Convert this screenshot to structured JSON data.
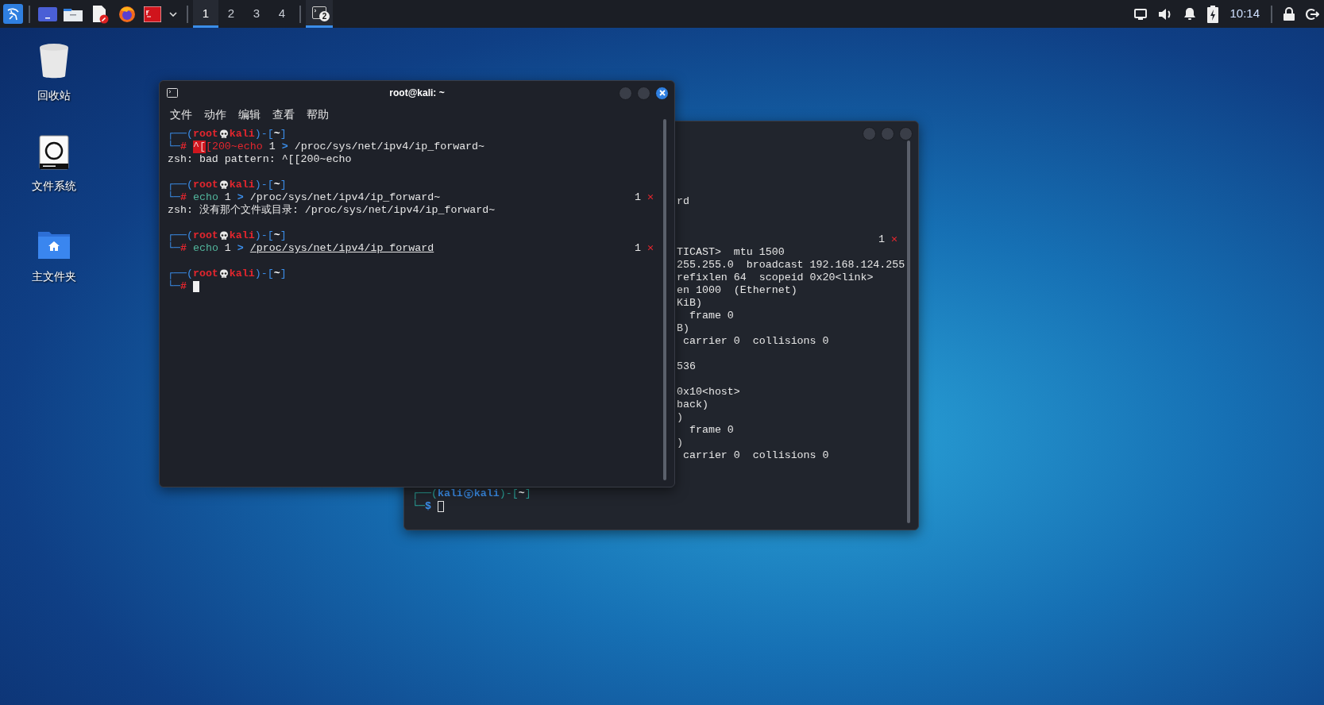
{
  "taskbar": {
    "workspaces": [
      {
        "label": "1",
        "selected": true
      },
      {
        "label": "2",
        "selected": false
      },
      {
        "label": "3",
        "selected": false
      },
      {
        "label": "4",
        "selected": false
      }
    ],
    "tasks": [
      {
        "badge": "2",
        "selected": true
      }
    ],
    "clock": "10:14"
  },
  "desktop_icons": [
    {
      "kind": "trash",
      "label": "回收站"
    },
    {
      "kind": "drive",
      "label": "文件系统"
    },
    {
      "kind": "home",
      "label": "主文件夹"
    }
  ],
  "windows": [
    {
      "title": "root@kali: ~",
      "active": true,
      "root": true,
      "menu": [
        "文件",
        "动作",
        "编辑",
        "查看",
        "帮助"
      ],
      "lines": [
        {
          "kind": "text",
          "cursor": false,
          "segments": [
            {
              "kind": "frame",
              "text": "┌──("
            },
            {
              "kind": "user",
              "text": "root"
            },
            {
              "kind": "skull"
            },
            {
              "kind": "host",
              "text": "kali"
            },
            {
              "kind": "frame",
              "text": ")-["
            },
            {
              "kind": "dir",
              "text": "~"
            },
            {
              "kind": "frame",
              "text": "]"
            }
          ]
        },
        {
          "kind": "text",
          "cursor": false,
          "segments": [
            {
              "kind": "frame",
              "text": "└─"
            },
            {
              "kind": "symbol",
              "text": "#"
            },
            {
              "kind": "esc",
              "text": "^["
            },
            {
              "kind": "badcmd",
              "text": "[200~echo"
            },
            {
              "kind": "arg",
              "text": " 1 "
            },
            {
              "kind": "op",
              "text": ">"
            },
            {
              "kind": "arg",
              "text": " /proc/sys/net/ipv4/ip_forward~"
            }
          ]
        },
        {
          "kind": "text",
          "cursor": false,
          "segments": [
            {
              "kind": "text",
              "text": "zsh: bad pattern: ^[[200~echo"
            }
          ]
        },
        {
          "kind": "blank"
        },
        {
          "kind": "text",
          "cursor": false,
          "segments": [
            {
              "kind": "frame",
              "text": "┌──("
            },
            {
              "kind": "user",
              "text": "root"
            },
            {
              "kind": "skull"
            },
            {
              "kind": "host",
              "text": "kali"
            },
            {
              "kind": "frame",
              "text": ")-["
            },
            {
              "kind": "dir",
              "text": "~"
            },
            {
              "kind": "frame",
              "text": "]"
            }
          ]
        },
        {
          "kind": "text",
          "cursor": false,
          "status": "1",
          "status_mark": "✕",
          "segments": [
            {
              "kind": "frame",
              "text": "└─"
            },
            {
              "kind": "symbol",
              "text": "#"
            },
            {
              "kind": "cmd",
              "text": "echo"
            },
            {
              "kind": "arg",
              "text": " 1 "
            },
            {
              "kind": "op",
              "text": ">"
            },
            {
              "kind": "arg",
              "text": " /proc/sys/net/ipv4/ip_forward~"
            }
          ]
        },
        {
          "kind": "text",
          "cursor": false,
          "segments": [
            {
              "kind": "text",
              "text": "zsh: 没有那个文件或目录: /proc/sys/net/ipv4/ip_forward~"
            }
          ]
        },
        {
          "kind": "blank"
        },
        {
          "kind": "text",
          "cursor": false,
          "segments": [
            {
              "kind": "frame",
              "text": "┌──("
            },
            {
              "kind": "user",
              "text": "root"
            },
            {
              "kind": "skull"
            },
            {
              "kind": "host",
              "text": "kali"
            },
            {
              "kind": "frame",
              "text": ")-["
            },
            {
              "kind": "dir",
              "text": "~"
            },
            {
              "kind": "frame",
              "text": "]"
            }
          ]
        },
        {
          "kind": "text",
          "cursor": false,
          "status": "1",
          "status_mark": "✕",
          "segments": [
            {
              "kind": "frame",
              "text": "└─"
            },
            {
              "kind": "symbol",
              "text": "#"
            },
            {
              "kind": "cmd",
              "text": "echo"
            },
            {
              "kind": "arg",
              "text": " 1 "
            },
            {
              "kind": "op",
              "text": ">"
            },
            {
              "kind": "path",
              "text": "/proc/sys/net/ipv4/ip_forward"
            }
          ]
        },
        {
          "kind": "blank"
        },
        {
          "kind": "text",
          "cursor": false,
          "segments": [
            {
              "kind": "frame",
              "text": "┌──("
            },
            {
              "kind": "user",
              "text": "root"
            },
            {
              "kind": "skull"
            },
            {
              "kind": "host",
              "text": "kali"
            },
            {
              "kind": "frame",
              "text": ")-["
            },
            {
              "kind": "dir",
              "text": "~"
            },
            {
              "kind": "frame",
              "text": "]"
            }
          ]
        },
        {
          "kind": "text",
          "cursor": true,
          "segments": [
            {
              "kind": "frame",
              "text": "└─"
            },
            {
              "kind": "symbol",
              "text": "#"
            }
          ]
        }
      ]
    },
    {
      "active": false,
      "root": false,
      "lines": [
        {
          "kind": "clipped",
          "cursor": false,
          "segments": [
            {
              "kind": "text",
              "text": "rd"
            }
          ]
        },
        {
          "kind": "blank"
        },
        {
          "kind": "blank"
        },
        {
          "kind": "clipped",
          "cursor": false,
          "status": "1",
          "status_mark": "✕"
        },
        {
          "kind": "clipped",
          "cursor": false,
          "segments": [
            {
              "kind": "text",
              "text": "TICAST>  mtu 1500"
            }
          ]
        },
        {
          "kind": "clipped",
          "cursor": false,
          "segments": [
            {
              "kind": "text",
              "text": "255.255.0  broadcast 192.168.124.255"
            }
          ]
        },
        {
          "kind": "clipped",
          "cursor": false,
          "segments": [
            {
              "kind": "text",
              "text": "refixlen 64  scopeid 0x20<link>"
            }
          ]
        },
        {
          "kind": "clipped",
          "cursor": false,
          "segments": [
            {
              "kind": "text",
              "text": "en 1000  (Ethernet)"
            }
          ]
        },
        {
          "kind": "clipped",
          "cursor": false,
          "segments": [
            {
              "kind": "text",
              "text": "KiB)"
            }
          ]
        },
        {
          "kind": "clipped",
          "cursor": false,
          "segments": [
            {
              "kind": "text",
              "text": "  frame 0"
            }
          ]
        },
        {
          "kind": "clipped",
          "cursor": false,
          "segments": [
            {
              "kind": "text",
              "text": "B)"
            }
          ]
        },
        {
          "kind": "clipped",
          "cursor": false,
          "segments": [
            {
              "kind": "text",
              "text": " carrier 0  collisions 0"
            }
          ]
        },
        {
          "kind": "blank"
        },
        {
          "kind": "clipped",
          "cursor": false,
          "segments": [
            {
              "kind": "text",
              "text": "536"
            }
          ]
        },
        {
          "kind": "blank"
        },
        {
          "kind": "clipped",
          "cursor": false,
          "segments": [
            {
              "kind": "text",
              "text": "0x10<host>"
            }
          ]
        },
        {
          "kind": "clipped",
          "cursor": false,
          "segments": [
            {
              "kind": "text",
              "text": "back)"
            }
          ]
        },
        {
          "kind": "clipped",
          "cursor": false,
          "segments": [
            {
              "kind": "text",
              "text": ")"
            }
          ]
        },
        {
          "kind": "clipped",
          "cursor": false,
          "segments": [
            {
              "kind": "text",
              "text": "  frame 0"
            }
          ]
        },
        {
          "kind": "clipped",
          "cursor": false,
          "segments": [
            {
              "kind": "text",
              "text": ")"
            }
          ]
        },
        {
          "kind": "clipped",
          "cursor": false,
          "segments": [
            {
              "kind": "text",
              "text": " carrier 0  collisions 0"
            }
          ]
        },
        {
          "kind": "blank"
        },
        {
          "kind": "blank"
        },
        {
          "kind": "text",
          "cursor": false,
          "segments": [
            {
              "kind": "frame",
              "text": "┌──("
            },
            {
              "kind": "user",
              "text": "kali"
            },
            {
              "kind": "seal"
            },
            {
              "kind": "host",
              "text": "kali"
            },
            {
              "kind": "frame",
              "text": ")-["
            },
            {
              "kind": "dir",
              "text": "~"
            },
            {
              "kind": "frame",
              "text": "]"
            }
          ]
        },
        {
          "kind": "text",
          "cursor": true,
          "segments": [
            {
              "kind": "frame",
              "text": "└─"
            },
            {
              "kind": "symbol",
              "text": "$"
            }
          ]
        }
      ]
    }
  ]
}
